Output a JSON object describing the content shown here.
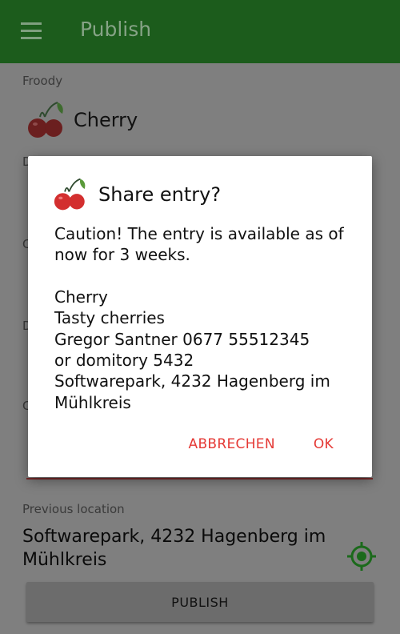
{
  "appbar": {
    "title": "Publish"
  },
  "form": {
    "food_label": "Froody",
    "food_name": "Cherry",
    "peek_labels": [
      "D",
      "C",
      "D",
      "C"
    ],
    "previous_location_label": "Previous location",
    "previous_location_line1": "Softwarepark, 4232 Hagenberg im",
    "previous_location_line2": "Mühlkreis",
    "publish_label": "PUBLISH"
  },
  "dialog": {
    "title": "Share entry?",
    "caution_line1": "Caution! The entry is available as of",
    "caution_line2": "now for 3 weeks.",
    "entry_name": "Cherry",
    "entry_description": "Tasty cherries",
    "contact_line1": "Gregor Santner 0677 55512345",
    "contact_line2": "or domitory 5432",
    "location_line1": "Softwarepark, 4232 Hagenberg im",
    "location_line2": "Mühlkreis",
    "cancel_label": "ABBRECHEN",
    "ok_label": "OK"
  },
  "colors": {
    "appbar": "#1c5c1c",
    "accent": "#e53935",
    "gps_icon": "#1b6a1b",
    "scrim": "#7f7f7f"
  },
  "icons": {
    "menu": "menu-icon",
    "food": "cherry-icon",
    "location": "gps-target-icon"
  }
}
